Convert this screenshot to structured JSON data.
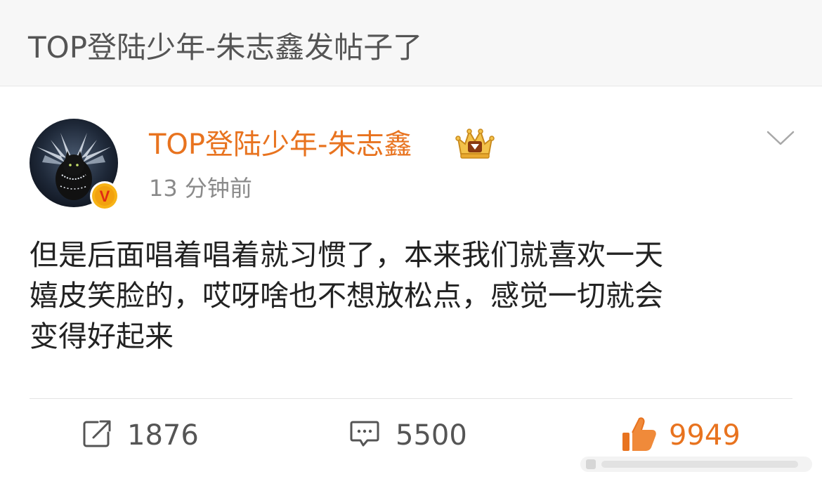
{
  "header": {
    "title": "TOP登陆少年-朱志鑫发帖子了"
  },
  "post": {
    "author": "TOP登陆少年-朱志鑫",
    "timestamp": "13 分钟前",
    "text_lines": [
      "但是后面唱着唱着就习惯了，本来我们就喜欢一天",
      "嬉皮笑脸的，哎呀啥也不想放松点，感觉一切就会",
      "变得好起来"
    ],
    "icons": {
      "verified": "verified-v-badge-icon",
      "vip": "crown-vip-icon",
      "menu": "chevron-down-icon"
    }
  },
  "actions": {
    "repost": {
      "icon": "share-icon",
      "count": "1876"
    },
    "comment": {
      "icon": "comment-icon",
      "count": "5500"
    },
    "like": {
      "icon": "thumbs-up-icon",
      "count": "9949"
    }
  },
  "colors": {
    "accent": "#e8731f",
    "header_bg": "#f7f7f7",
    "text": "#222222",
    "muted": "#8a8a8a"
  }
}
